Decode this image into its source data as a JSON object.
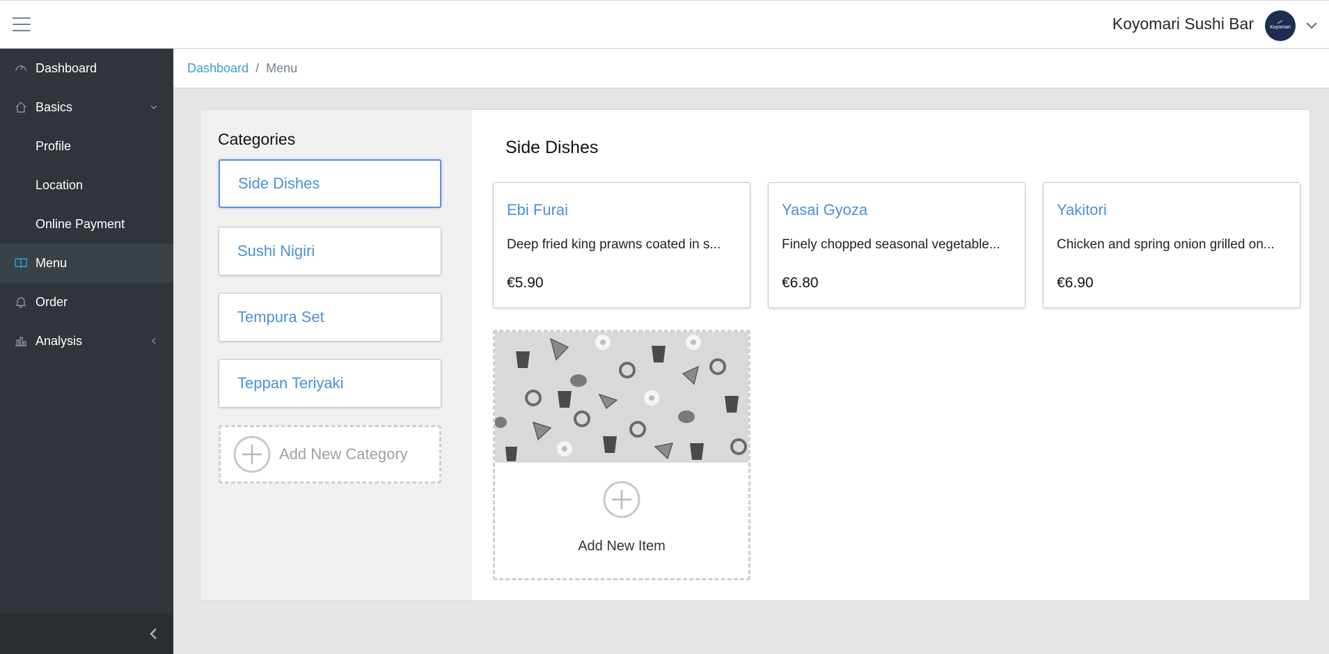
{
  "header": {
    "brand_name": "Koyomari Sushi Bar",
    "avatar_text": "Koyomari"
  },
  "sidebar": {
    "items": [
      {
        "label": "Dashboard",
        "icon": "speedometer-icon"
      },
      {
        "label": "Basics",
        "icon": "home-icon"
      },
      {
        "label": "Profile"
      },
      {
        "label": "Location"
      },
      {
        "label": "Online Payment"
      },
      {
        "label": "Menu",
        "icon": "book-icon",
        "active": true
      },
      {
        "label": "Order",
        "icon": "bell-icon"
      },
      {
        "label": "Analysis",
        "icon": "bar-chart-icon"
      }
    ]
  },
  "breadcrumb": {
    "link": "Dashboard",
    "separator": "/",
    "current": "Menu"
  },
  "categories": {
    "title": "Categories",
    "items": [
      "Side Dishes",
      "Sushi Nigiri",
      "Tempura Set",
      "Teppan Teriyaki"
    ],
    "selected": "Side Dishes",
    "add_label": "Add New Category"
  },
  "items_section": {
    "title": "Side Dishes",
    "items": [
      {
        "name": "Ebi Furai",
        "description": "Deep fried king prawns coated in s...",
        "price": "€5.90"
      },
      {
        "name": "Yasai Gyoza",
        "description": "Finely chopped seasonal vegetable...",
        "price": "€6.80"
      },
      {
        "name": "Yakitori",
        "description": "Chicken and spring onion grilled on...",
        "price": "€6.90"
      }
    ],
    "add_label": "Add New Item"
  },
  "colors": {
    "accent": "#4a8fd8",
    "sidebar_bg": "#2f353a",
    "avatar_bg": "#1f2c52"
  }
}
